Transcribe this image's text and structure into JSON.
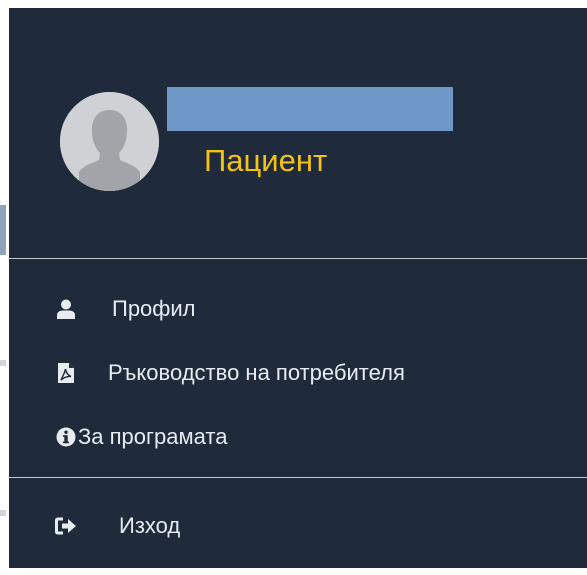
{
  "user": {
    "avatar_icon": "default-user-avatar",
    "name_redacted_color": "#6f97c8",
    "role": "Пациент",
    "role_color": "#f2c313"
  },
  "menu": {
    "background": "#1f2a3b",
    "items": [
      {
        "label": "Профил",
        "icon": "user-icon"
      },
      {
        "label": "Ръководство на потребителя",
        "icon": "pdf-file-icon"
      },
      {
        "label": "За програмата",
        "icon": "info-circle-icon"
      }
    ],
    "logout": {
      "label": "Изход",
      "icon": "sign-out-icon"
    }
  }
}
